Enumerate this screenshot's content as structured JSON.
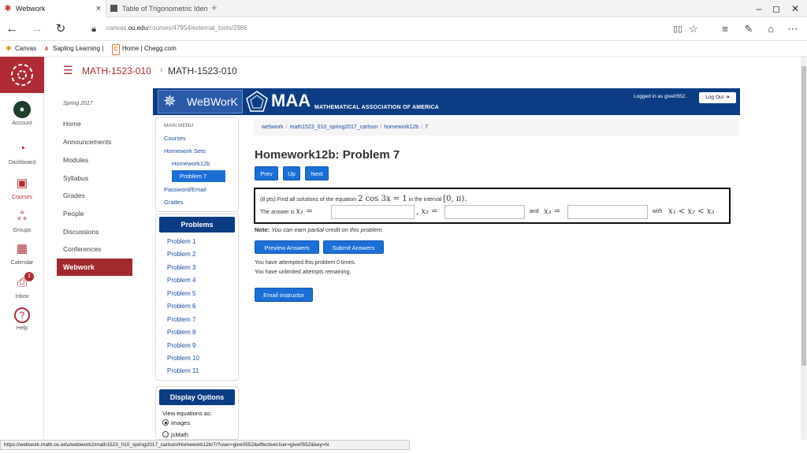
{
  "browser": {
    "tabs": [
      {
        "label": "Webwork",
        "close": "×"
      },
      {
        "label": "Table of Trigonometric Iden"
      }
    ],
    "new_tab": "+",
    "window_controls": {
      "minimize": "–",
      "restore": "◻",
      "close": "✕"
    },
    "url_prefix": "canvas.",
    "url_domain": "ou.edu",
    "url_path": "/courses/47954/external_tools/2986",
    "favorites": [
      {
        "label": "Canvas",
        "icon": "✱"
      },
      {
        "label": "Sapling Learning |",
        "icon": "∧"
      },
      {
        "label": "Home | Chegg.com",
        "icon": "C"
      }
    ],
    "status_url": "https://webwork.math.ou.edu/webwork2/math1523_010_spring2017_carlson/Homework12b/7/?user=give0552&effectiveUser=give0552&key=N"
  },
  "canvas_nav": [
    {
      "label": "Account",
      "icon": "account-icon"
    },
    {
      "label": "Dashboard",
      "icon": "dashboard-icon"
    },
    {
      "label": "Courses",
      "icon": "courses-icon"
    },
    {
      "label": "Groups",
      "icon": "groups-icon"
    },
    {
      "label": "Calendar",
      "icon": "calendar-icon"
    },
    {
      "label": "Inbox",
      "icon": "inbox-icon",
      "badge": "1"
    },
    {
      "label": "Help",
      "icon": "help-icon"
    }
  ],
  "header": {
    "breadcrumb_course": "MATH-1523-010",
    "breadcrumb_separator": "›",
    "breadcrumb_current": "MATH-1523-010"
  },
  "course_nav": {
    "term": "Spring 2017",
    "items": [
      "Home",
      "Announcements",
      "Modules",
      "Syllabus",
      "Grades",
      "People",
      "Discussions",
      "Conferences"
    ],
    "active": "Webwork"
  },
  "webwork": {
    "logo": "WeBWorK",
    "maa": "MAA",
    "maa_sub": "MATHEMATICAL ASSOCIATION OF AMERICA",
    "logged_in": "Logged in as give0552.",
    "logout": "Log Out",
    "main_menu_title": "MAIN MENU",
    "main_menu": {
      "courses": "Courses",
      "homework_sets": "Homework Sets",
      "homework12b": "Homework12b",
      "problem7": "Problem 7",
      "password_email": "Password/Email",
      "grades": "Grades"
    },
    "problems_title": "Problems",
    "problems": [
      "Problem 1",
      "Problem 2",
      "Problem 3",
      "Problem 4",
      "Problem 5",
      "Problem 6",
      "Problem 7",
      "Problem 8",
      "Problem 9",
      "Problem 10",
      "Problem 11"
    ],
    "display_title": "Display Options",
    "view_equations": "View equations as:",
    "option_images": "images",
    "option_jsmath": "jsMath",
    "crumbs": [
      "webwork",
      "math1523_010_spring2017_carlson",
      "homework12b",
      "7"
    ],
    "crumb_sep": "/",
    "page_title": "Homework12b: Problem 7",
    "nav_buttons": {
      "prev": "Prev",
      "up": "Up",
      "next": "Next"
    },
    "problem": {
      "intro": "(8 pts) Find all solutions of the equation",
      "equation": "2 cos 3x = 1",
      "in_interval": "in the interval",
      "interval": "[0, π).",
      "answer_is": "The answer is",
      "x1_label": "x₁ =",
      "x2_label": ", x₂ =",
      "and": "and",
      "x3_label": "x₃ =",
      "with": "with",
      "ordering": "x₁ < x₂ < x₃"
    },
    "note_label": "Note:",
    "note_text": "You can earn partial credit on this problem.",
    "preview_button": "Preview Answers",
    "submit_button": "Submit Answers",
    "attempted": "You have attempted this problem 0 times.",
    "unlimited": "You have unlimited attempts remaining.",
    "email_button": "Email instructor"
  },
  "colors": {
    "canvas_red": "#b02b35",
    "webwork_navy": "#0c3d84",
    "button_blue": "#1b6fd6"
  }
}
